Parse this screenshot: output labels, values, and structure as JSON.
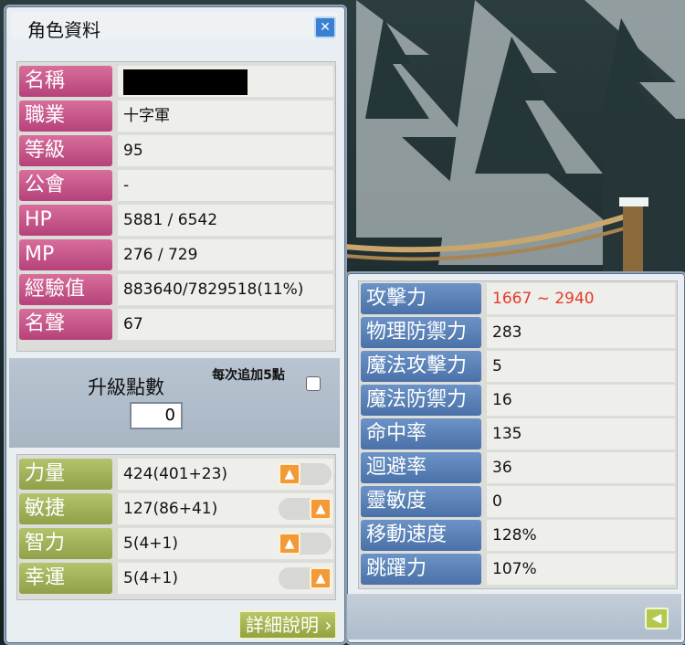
{
  "character_window": {
    "title": "角色資料",
    "close_icon": "close-icon",
    "info_rows": [
      {
        "label": "名稱",
        "value": ""
      },
      {
        "label": "職業",
        "value": "十字軍"
      },
      {
        "label": "等級",
        "value": "95"
      },
      {
        "label": "公會",
        "value": "-"
      },
      {
        "label": "HP",
        "value": "5881 / 6542"
      },
      {
        "label": "MP",
        "value": "276 / 729"
      },
      {
        "label": "經驗值",
        "value": "883640/7829518(11%)"
      },
      {
        "label": "名聲",
        "value": "67"
      }
    ],
    "upgrade": {
      "label": "升級點數",
      "points": "0",
      "add5_label": "每次追加5點",
      "add5_checked": false
    },
    "stats": [
      {
        "label": "力量",
        "value": "424(401+23)"
      },
      {
        "label": "敏捷",
        "value": "127(86+41)"
      },
      {
        "label": "智力",
        "value": "5(4+1)"
      },
      {
        "label": "幸運",
        "value": "5(4+1)"
      }
    ],
    "detail_button_label": "詳細說明"
  },
  "detail_window": {
    "rows": [
      {
        "label": "攻擊力",
        "value": "1667 ~ 2940"
      },
      {
        "label": "物理防禦力",
        "value": "283"
      },
      {
        "label": "魔法攻擊力",
        "value": "5"
      },
      {
        "label": "魔法防禦力",
        "value": "16"
      },
      {
        "label": "命中率",
        "value": "135"
      },
      {
        "label": "迴避率",
        "value": "36"
      },
      {
        "label": "靈敏度",
        "value": "0"
      },
      {
        "label": "移動速度",
        "value": "128%"
      },
      {
        "label": "跳躍力",
        "value": "107%"
      }
    ]
  },
  "colors": {
    "label_pink": "#c4578a",
    "label_green": "#a0b458",
    "label_blue": "#5a82b8",
    "attack_value": "#e63a2a",
    "arrow_button": "#f29a38"
  }
}
